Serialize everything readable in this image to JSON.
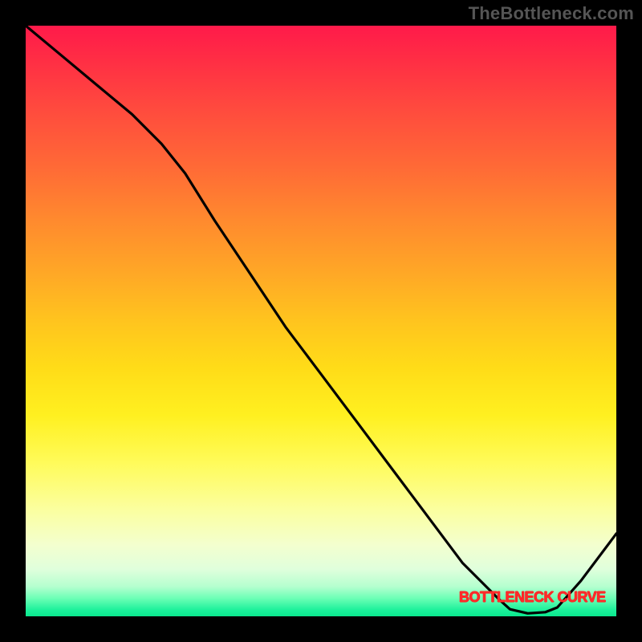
{
  "watermark": "TheBottleneck.com",
  "label_text": "BOTTLENECK CURVE",
  "chart_data": {
    "type": "line",
    "title": "",
    "xlabel": "",
    "ylabel": "",
    "xlim": [
      0,
      100
    ],
    "ylim": [
      0,
      100
    ],
    "series": [
      {
        "name": "bottleneck-curve",
        "x": [
          0,
          6,
          12,
          18,
          23,
          27,
          32,
          38,
          44,
          50,
          56,
          62,
          68,
          74,
          80,
          82,
          85,
          88,
          90,
          94,
          100
        ],
        "values": [
          100,
          95,
          90,
          85,
          80,
          75,
          67,
          58,
          49,
          41,
          33,
          25,
          17,
          9,
          3,
          1.2,
          0.5,
          0.7,
          1.5,
          6,
          14
        ]
      }
    ],
    "annotations": [
      {
        "text": "BOTTLENECK CURVE",
        "x": 84,
        "y": 2
      }
    ],
    "background_gradient": {
      "top": "#ff1a4a",
      "middle": "#ffdc18",
      "bottom": "#0ae88e"
    }
  }
}
